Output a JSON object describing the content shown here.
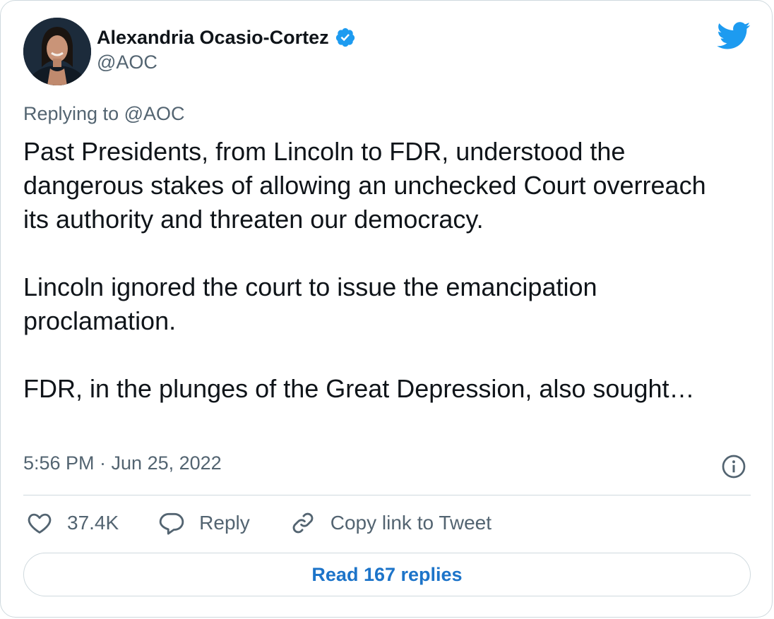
{
  "author": {
    "display_name": "Alexandria Ocasio-Cortez",
    "handle": "@AOC",
    "verified": true
  },
  "icons": {
    "avatar": "profile-photo",
    "verified": "verified-badge-icon",
    "brand": "twitter-bird-icon",
    "info": "info-icon",
    "like": "heart-icon",
    "reply": "speech-bubble-icon",
    "copy_link": "link-icon"
  },
  "reply_context": "Replying to @AOC",
  "tweet": {
    "paragraphs": [
      "Past Presidents, from Lincoln to FDR, understood the dangerous stakes of allowing an unchecked Court overreach its authority and threaten our democracy.",
      "Lincoln ignored the court to issue the emancipation proclamation.",
      "FDR, in the plunges of the Great Depression, also sought…"
    ],
    "timestamp": "5:56 PM · Jun 25, 2022"
  },
  "actions": {
    "like_count": "37.4K",
    "reply_label": "Reply",
    "copy_link_label": "Copy link to Tweet"
  },
  "read_replies_label": "Read 167 replies",
  "colors": {
    "brand_blue": "#1d9bf0",
    "link_blue": "#1d74c9",
    "text_primary": "#0f1419",
    "text_secondary": "#536471",
    "border": "#cfd9de"
  }
}
